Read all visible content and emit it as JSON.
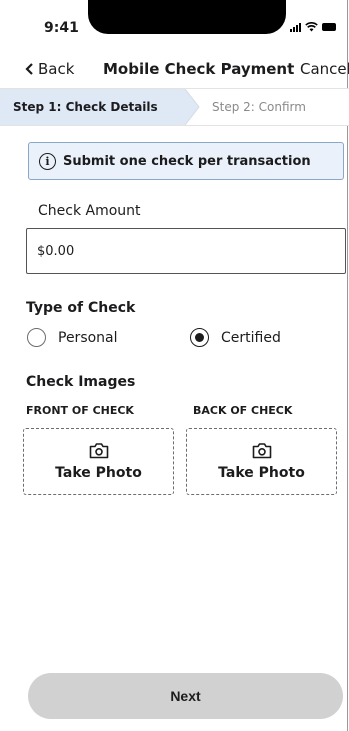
{
  "status_bar": {
    "time": "9:41"
  },
  "nav": {
    "back_label": "Back",
    "title": "Mobile Check Payment",
    "cancel_label": "Cancel"
  },
  "stepper": {
    "steps": [
      {
        "label": "Step 1: Check Details",
        "active": true
      },
      {
        "label": "Step 2: Confirm",
        "active": false
      }
    ]
  },
  "info_banner": {
    "icon": "info-icon",
    "text": "Submit one check per transaction"
  },
  "amount": {
    "label": "Check Amount",
    "value": "$0.00"
  },
  "check_type": {
    "heading": "Type of Check",
    "options": [
      {
        "label": "Personal",
        "selected": false
      },
      {
        "label": "Certified",
        "selected": true
      }
    ]
  },
  "check_images": {
    "heading": "Check Images",
    "front": {
      "label": "FRONT OF CHECK",
      "button": "Take Photo",
      "icon": "camera-icon"
    },
    "back": {
      "label": "BACK OF CHECK",
      "button": "Take Photo",
      "icon": "camera-icon"
    }
  },
  "footer": {
    "next_label": "Next"
  },
  "colors": {
    "step_active_bg": "#dfe9f6",
    "banner_bg": "#eaf1fa",
    "banner_border": "#8aa6c8",
    "next_bg": "#d1d1d1"
  }
}
